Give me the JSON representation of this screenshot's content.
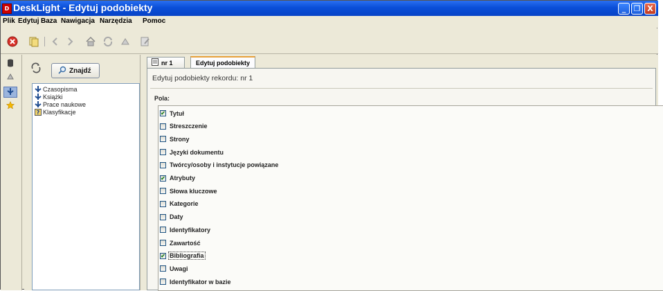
{
  "window": {
    "app_icon_letter": "D",
    "title": "DeskLight - Edytuj podobiekty",
    "controls": {
      "minimize": "_",
      "restore": "❐",
      "close": "X"
    }
  },
  "menu": [
    "Plik",
    "Edytuj",
    "Baza",
    "Nawigacja",
    "Narzędzia",
    "Pomoc"
  ],
  "toolbar": {
    "icons": [
      "stop-icon",
      "copy-icon",
      "back-icon",
      "forward-icon",
      "home-icon",
      "refresh-icon",
      "forward-link-icon",
      "edit-icon"
    ]
  },
  "left_panel": {
    "search_button_label": "Znajdź",
    "tree_items": [
      {
        "label": "Czasopisma",
        "icon": "tree-folder-icon"
      },
      {
        "label": "Książki",
        "icon": "tree-folder-icon"
      },
      {
        "label": "Prace naukowe",
        "icon": "tree-folder-icon"
      },
      {
        "label": "Klasyfikacje",
        "icon": "tree-question-icon"
      }
    ]
  },
  "tabs": [
    {
      "label": "nr 1",
      "active": false
    },
    {
      "label": "Edytuj podobiekty",
      "active": true
    }
  ],
  "panel": {
    "heading": "Edytuj podobiekty rekordu: nr 1",
    "fields_label": "Pola:",
    "fields": [
      {
        "label": "Tytuł",
        "checked": true
      },
      {
        "label": "Streszczenie",
        "checked": false
      },
      {
        "label": "Strony",
        "checked": false
      },
      {
        "label": "Języki dokumentu",
        "checked": false
      },
      {
        "label": "Twórcy/osoby i instytucje powiązane",
        "checked": false
      },
      {
        "label": "Atrybuty",
        "checked": true
      },
      {
        "label": "Słowa kluczowe",
        "checked": false
      },
      {
        "label": "Kategorie",
        "checked": false
      },
      {
        "label": "Daty",
        "checked": false
      },
      {
        "label": "Identyfikatory",
        "checked": false
      },
      {
        "label": "Zawartość",
        "checked": false
      },
      {
        "label": "Bibliografia",
        "checked": true
      },
      {
        "label": "Uwagi",
        "checked": false
      },
      {
        "label": "Identyfikator w bazie",
        "checked": false
      }
    ]
  },
  "colors": {
    "titlebar": "#0a4fd8",
    "window_bg": "#ece9d8",
    "tab_accent": "#e7a03a",
    "check": "#1f7e1f"
  }
}
